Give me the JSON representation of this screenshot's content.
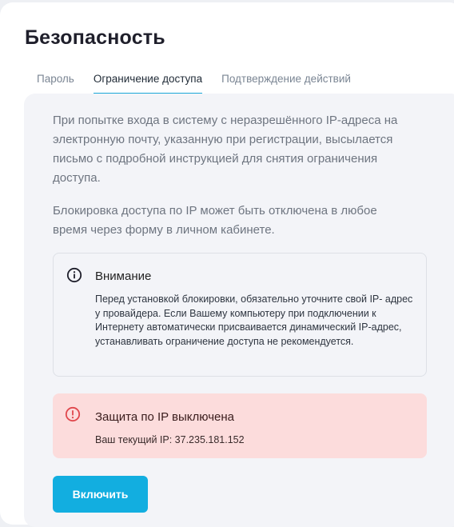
{
  "page": {
    "title": "Безопасность"
  },
  "tabs": [
    {
      "label": "Пароль",
      "active": false
    },
    {
      "label": "Ограничение доступа",
      "active": true
    },
    {
      "label": "Подтверждение действий",
      "active": false
    }
  ],
  "content": {
    "paragraph1": "При попытке входа в систему с неразрешённого IP-адреса на электронную почту, указанную при регистрации, высылается письмо с подробной инструкцией для снятия ограничения доступа.",
    "paragraph2": "Блокировка доступа по IP может быть отключена в любое время через форму в личном кабинете."
  },
  "notice": {
    "icon": "info-icon",
    "title": "Внимание",
    "text": "Перед установкой блокировки, обязательно уточните свой IP- адрес у провайдера. Если Вашему компьютеру при подключении к Интернету автоматически присваивается динамический IP-адрес, устанавливать ограничение доступа не рекомендуется."
  },
  "alert": {
    "icon": "alert-circle-icon",
    "title": "Защита по IP выключена",
    "text": "Ваш текущий IP: 37.235.181.152",
    "icon_color": "#e0474c"
  },
  "actions": {
    "enable_label": "Включить"
  },
  "colors": {
    "accent": "#12aee0",
    "tab_underline": "#1aa6d8",
    "alert_background": "#fcdcdc",
    "panel_background": "#f3f4f8"
  }
}
